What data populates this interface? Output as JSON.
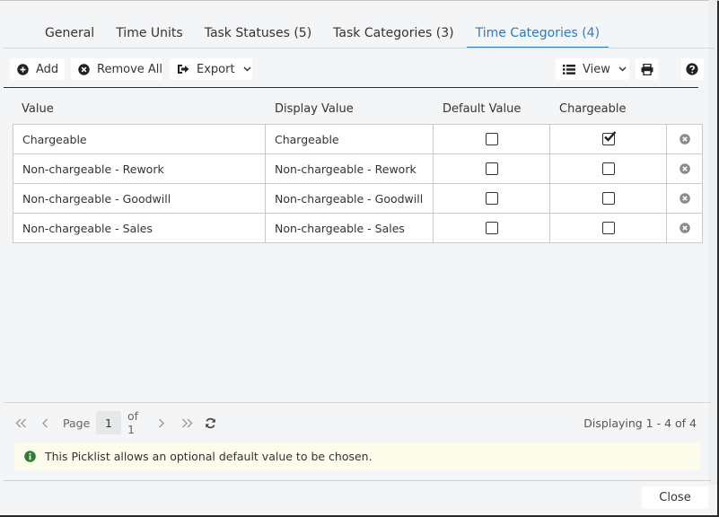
{
  "tabs": [
    {
      "label": "General",
      "active": false
    },
    {
      "label": "Time Units",
      "active": false
    },
    {
      "label": "Task Statuses (5)",
      "active": false
    },
    {
      "label": "Task Categories (3)",
      "active": false
    },
    {
      "label": "Time Categories (4)",
      "active": true
    }
  ],
  "toolbar": {
    "add_label": "Add",
    "remove_all_label": "Remove All",
    "export_label": "Export",
    "view_label": "View"
  },
  "grid": {
    "columns": [
      "Value",
      "Display Value",
      "Default Value",
      "Chargeable"
    ],
    "rows": [
      {
        "value": "Chargeable",
        "display_value": "Chargeable",
        "default_value": false,
        "chargeable": true
      },
      {
        "value": "Non-chargeable - Rework",
        "display_value": "Non-chargeable - Rework",
        "default_value": false,
        "chargeable": false
      },
      {
        "value": "Non-chargeable - Goodwill",
        "display_value": "Non-chargeable - Goodwill",
        "default_value": false,
        "chargeable": false
      },
      {
        "value": "Non-chargeable - Sales",
        "display_value": "Non-chargeable - Sales",
        "default_value": false,
        "chargeable": false
      }
    ]
  },
  "pager": {
    "page_label": "Page",
    "current_page": "1",
    "of_label": "of 1",
    "displaying": "Displaying 1 - 4 of 4"
  },
  "info_message": "This Picklist allows an optional default value to be chosen.",
  "close_label": "Close",
  "colors": {
    "accent": "#2a7bc7",
    "info_icon": "#2e7d32",
    "info_bg": "#fdfcea"
  }
}
